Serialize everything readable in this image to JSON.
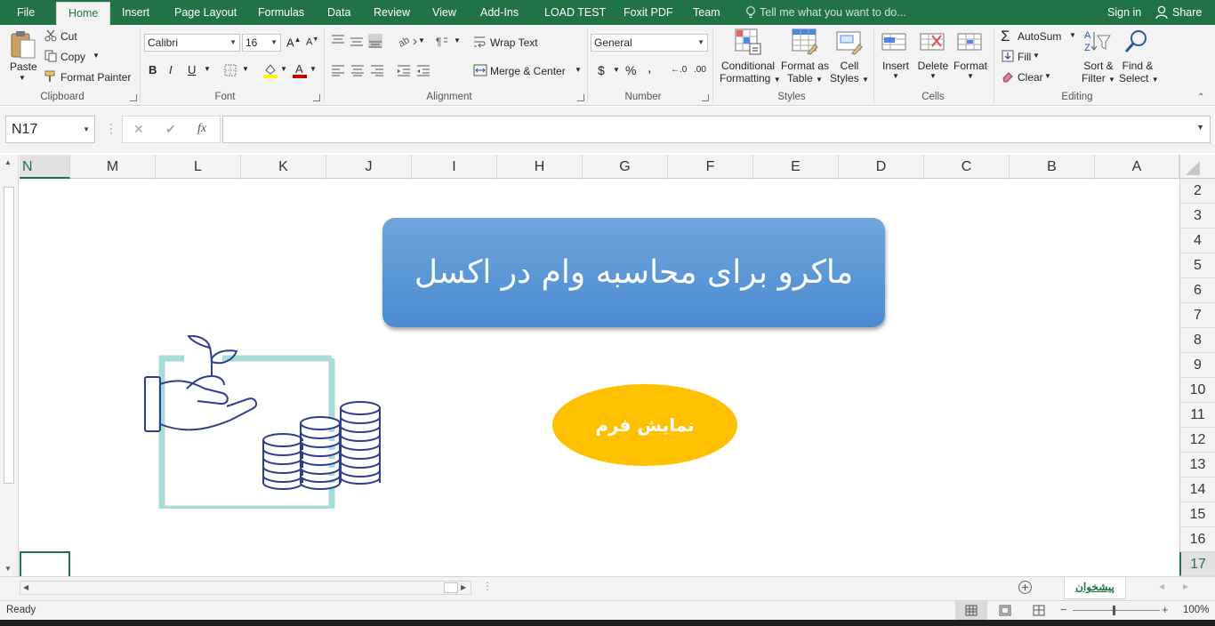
{
  "tabs": {
    "file": "File",
    "home": "Home",
    "insert": "Insert",
    "page_layout": "Page Layout",
    "formulas": "Formulas",
    "data": "Data",
    "review": "Review",
    "view": "View",
    "add_ins": "Add-Ins",
    "load_test": "LOAD TEST",
    "foxit_pdf": "Foxit PDF",
    "team": "Team",
    "tell_me": "Tell me what you want to do...",
    "sign_in": "Sign in",
    "share": "Share"
  },
  "clipboard": {
    "paste": "Paste",
    "cut": "Cut",
    "copy": "Copy",
    "format_painter": "Format Painter",
    "label": "Clipboard"
  },
  "font": {
    "family": "Calibri",
    "size": "16",
    "bold": "B",
    "italic": "I",
    "underline": "U",
    "label": "Font"
  },
  "alignment": {
    "wrap_text": "Wrap Text",
    "merge_center": "Merge & Center",
    "label": "Alignment"
  },
  "number": {
    "format": "General",
    "currency": "$",
    "percent": "%",
    "comma": ",",
    "inc_decimal": "←.0",
    "dec_decimal": ".00",
    "label": "Number"
  },
  "styles": {
    "conditional_1": "Conditional",
    "conditional_2": "Formatting",
    "table_1": "Format as",
    "table_2": "Table",
    "cell_1": "Cell",
    "cell_2": "Styles",
    "label": "Styles"
  },
  "cells": {
    "insert": "Insert",
    "delete": "Delete",
    "format": "Format",
    "label": "Cells"
  },
  "editing": {
    "autosum": "AutoSum",
    "fill": "Fill",
    "clear": "Clear",
    "sort_1": "Sort &",
    "sort_2": "Filter",
    "find_1": "Find &",
    "find_2": "Select",
    "label": "Editing"
  },
  "formula_bar": {
    "name_box": "N17",
    "cancel": "✕",
    "enter": "✔",
    "fx": "fx",
    "value": ""
  },
  "columns": [
    "N",
    "M",
    "L",
    "K",
    "J",
    "I",
    "H",
    "G",
    "F",
    "E",
    "D",
    "C",
    "B",
    "A"
  ],
  "rows": [
    "2",
    "3",
    "4",
    "5",
    "6",
    "7",
    "8",
    "9",
    "10",
    "11",
    "12",
    "13",
    "14",
    "15",
    "16",
    "17"
  ],
  "sheet": {
    "title": "ماکرو برای محاسبه وام در اکسل",
    "button": "نمایش فرم",
    "title_color": "#5b9bd5",
    "button_color": "#ffc000"
  },
  "sheet_tabs": {
    "active": "پیشخوان"
  },
  "status": {
    "ready": "Ready",
    "zoom": "100%"
  }
}
